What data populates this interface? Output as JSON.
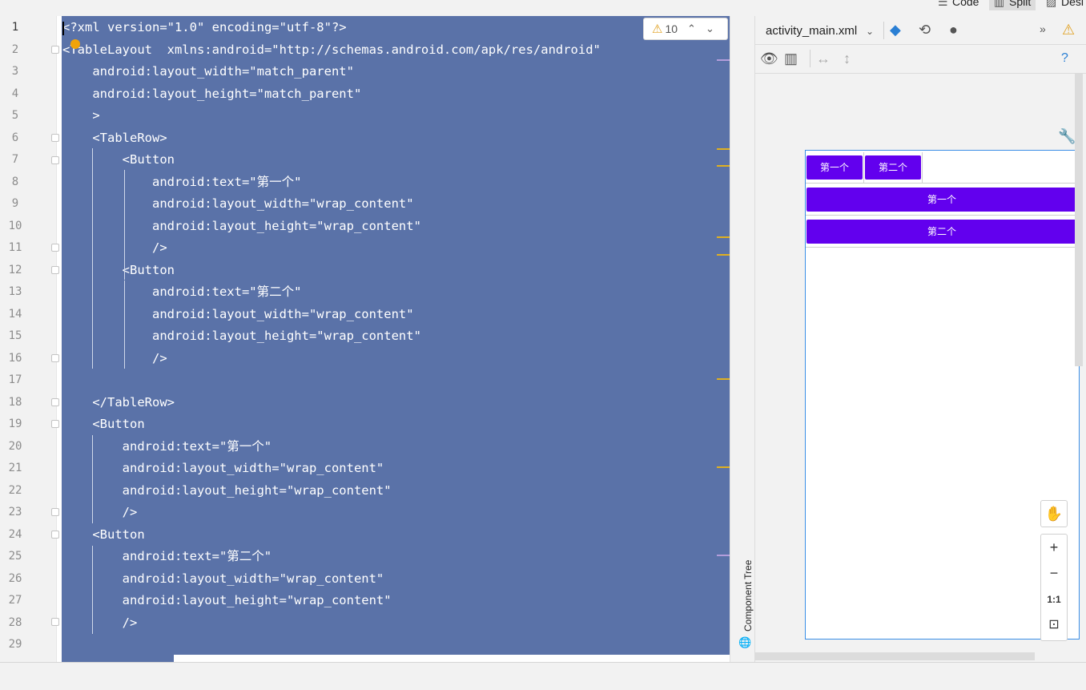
{
  "view_modes": {
    "code": "Code",
    "split": "Split",
    "design": "Desi"
  },
  "editor": {
    "line_numbers": [
      "1",
      "2",
      "3",
      "4",
      "5",
      "6",
      "7",
      "8",
      "9",
      "10",
      "11",
      "12",
      "13",
      "14",
      "15",
      "16",
      "17",
      "18",
      "19",
      "20",
      "21",
      "22",
      "23",
      "24",
      "25",
      "26",
      "27",
      "28",
      "29"
    ],
    "lines": [
      "<?xml version=\"1.0\" encoding=\"utf-8\"?>",
      "<TableLayout  xmlns:android=\"http://schemas.android.com/apk/res/android\"",
      "    android:layout_width=\"match_parent\"",
      "    android:layout_height=\"match_parent\"",
      "    >",
      "    <TableRow>",
      "        <Button",
      "            android:text=\"第一个\"",
      "            android:layout_width=\"wrap_content\"",
      "            android:layout_height=\"wrap_content\"",
      "            />",
      "        <Button",
      "            android:text=\"第二个\"",
      "            android:layout_width=\"wrap_content\"",
      "            android:layout_height=\"wrap_content\"",
      "            />",
      "",
      "    </TableRow>",
      "    <Button",
      "        android:text=\"第一个\"",
      "        android:layout_width=\"wrap_content\"",
      "        android:layout_height=\"wrap_content\"",
      "        />",
      "    <Button",
      "        android:text=\"第二个\"",
      "        android:layout_width=\"wrap_content\"",
      "        android:layout_height=\"wrap_content\"",
      "        />",
      ""
    ],
    "warning_count": "10",
    "selection_color": "#5a72a8"
  },
  "component_tree_label": "Component Tree",
  "design": {
    "file_name": "activity_main.xml",
    "preview_buttons": {
      "row_button_1": "第一个",
      "row_button_2": "第二个",
      "full_button_1": "第一个",
      "full_button_2": "第二个"
    },
    "button_color": "#6200ee",
    "zoom": {
      "plus": "+",
      "minus": "−",
      "one_to_one": "1:1"
    }
  },
  "icons": {
    "warning": "warning-icon",
    "up": "chevron-up-icon",
    "down": "chevron-down-icon",
    "help": "help-icon"
  }
}
